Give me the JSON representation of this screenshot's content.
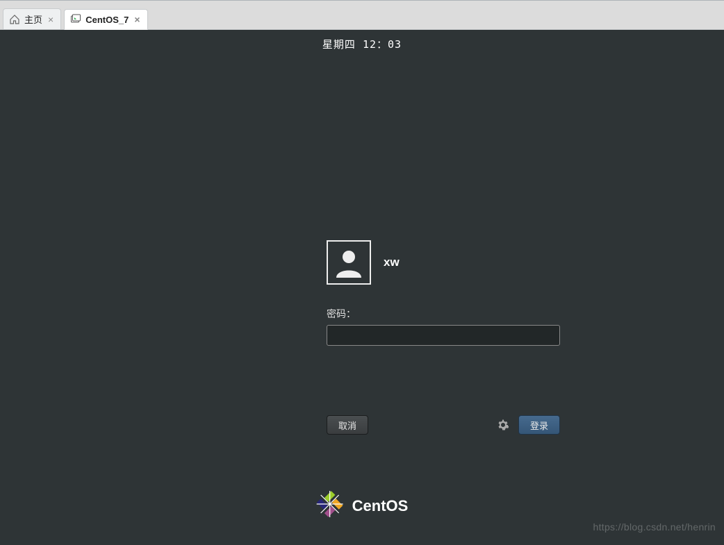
{
  "tabs": {
    "home": {
      "label": "主页"
    },
    "vm": {
      "label": "CentOS_7"
    }
  },
  "vm": {
    "clock": "星期四 12：03",
    "username": "xw",
    "password_label": "密码：",
    "password_value": "",
    "cancel_label": "取消",
    "login_label": "登录",
    "distro": "CentOS"
  },
  "watermark": "https://blog.csdn.net/henrin"
}
